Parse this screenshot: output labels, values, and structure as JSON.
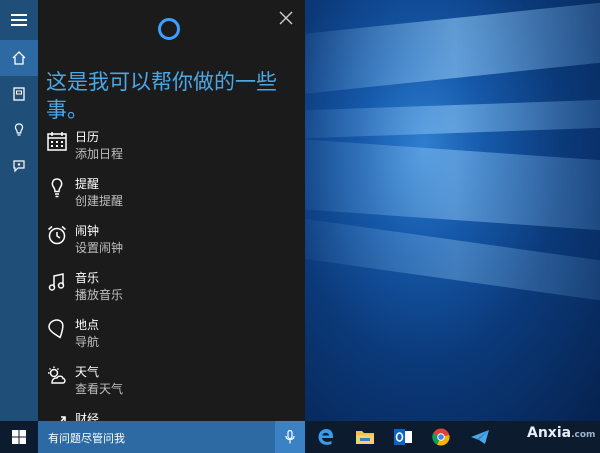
{
  "panel": {
    "headline": "这是我可以帮你做的一些事。",
    "items": [
      {
        "title": "日历",
        "subtitle": "添加日程",
        "icon": "calendar-icon"
      },
      {
        "title": "提醒",
        "subtitle": "创建提醒",
        "icon": "lightbulb-icon"
      },
      {
        "title": "闹钟",
        "subtitle": "设置闹钟",
        "icon": "alarm-clock-icon"
      },
      {
        "title": "音乐",
        "subtitle": "播放音乐",
        "icon": "music-note-icon"
      },
      {
        "title": "地点",
        "subtitle": "导航",
        "icon": "location-pin-icon"
      },
      {
        "title": "天气",
        "subtitle": "查看天气",
        "icon": "weather-icon"
      },
      {
        "title": "财经",
        "subtitle": "",
        "icon": "finance-chart-icon"
      }
    ]
  },
  "search": {
    "placeholder": "有问题尽管问我"
  },
  "watermark": {
    "brand": "Anxia",
    "domain": ".com"
  },
  "colors": {
    "accent": "#2d6aa3",
    "headline": "#4aa8e8",
    "panel_bg": "#1b1b1b"
  }
}
